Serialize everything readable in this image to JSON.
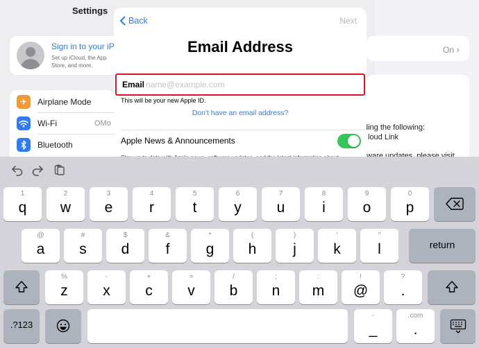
{
  "background": {
    "sidebar_title": "Settings",
    "signin_title": "Sign in to your iPa",
    "signin_sub": "Set up iCloud, the App Store, and more.",
    "rows": [
      {
        "label": "Airplane Mode",
        "value": "",
        "icon": "airplane-icon",
        "color": "#f09a37"
      },
      {
        "label": "Wi-Fi",
        "value": "OMo",
        "icon": "wifi-icon",
        "color": "#2f7bf5"
      },
      {
        "label": "Bluetooth",
        "value": "",
        "icon": "bluetooth-icon",
        "color": "#2f7bf5"
      }
    ],
    "right_value": "On",
    "right_frag1": "ding the following:",
    "right_frag2": "loud Link",
    "right_frag3": "ftware updates, please visit"
  },
  "modal": {
    "back_label": "Back",
    "next_label": "Next",
    "title": "Email Address",
    "email_label": "Email",
    "email_value": "",
    "email_placeholder": "name@example.com",
    "helper": "This will be your new Apple ID.",
    "no_email_link": "Don't have an email address?",
    "news_label": "Apple News & Announcements",
    "news_toggle_on": true,
    "news_desc": "Stay up to date with Apple news, software updates, and the latest information about"
  },
  "keyboard": {
    "toolbar": [
      "undo-icon",
      "redo-icon",
      "paste-icon"
    ],
    "row1": [
      {
        "main": "q",
        "alt": "1"
      },
      {
        "main": "w",
        "alt": "2"
      },
      {
        "main": "e",
        "alt": "3"
      },
      {
        "main": "r",
        "alt": "4"
      },
      {
        "main": "t",
        "alt": "5"
      },
      {
        "main": "y",
        "alt": "6"
      },
      {
        "main": "u",
        "alt": "7"
      },
      {
        "main": "i",
        "alt": "8"
      },
      {
        "main": "o",
        "alt": "9"
      },
      {
        "main": "p",
        "alt": "0"
      }
    ],
    "row2": [
      {
        "main": "a",
        "alt": "@"
      },
      {
        "main": "s",
        "alt": "#"
      },
      {
        "main": "d",
        "alt": "$"
      },
      {
        "main": "f",
        "alt": "&"
      },
      {
        "main": "g",
        "alt": "*"
      },
      {
        "main": "h",
        "alt": "("
      },
      {
        "main": "j",
        "alt": ")"
      },
      {
        "main": "k",
        "alt": "'"
      },
      {
        "main": "l",
        "alt": "\""
      }
    ],
    "row3": [
      {
        "main": "z",
        "alt": "%"
      },
      {
        "main": "x",
        "alt": "-"
      },
      {
        "main": "c",
        "alt": "+"
      },
      {
        "main": "v",
        "alt": "="
      },
      {
        "main": "b",
        "alt": "/"
      },
      {
        "main": "n",
        "alt": ";"
      },
      {
        "main": "m",
        "alt": ":"
      },
      {
        "main": "@",
        "alt": "!"
      },
      {
        "main": ".",
        "alt": "?"
      }
    ],
    "return_label": "return",
    "numbers_label": ".?123",
    "underscore": {
      "main": "_",
      "alt": "-"
    },
    "dotcom": {
      "main": ".",
      "alt": ".com"
    }
  }
}
